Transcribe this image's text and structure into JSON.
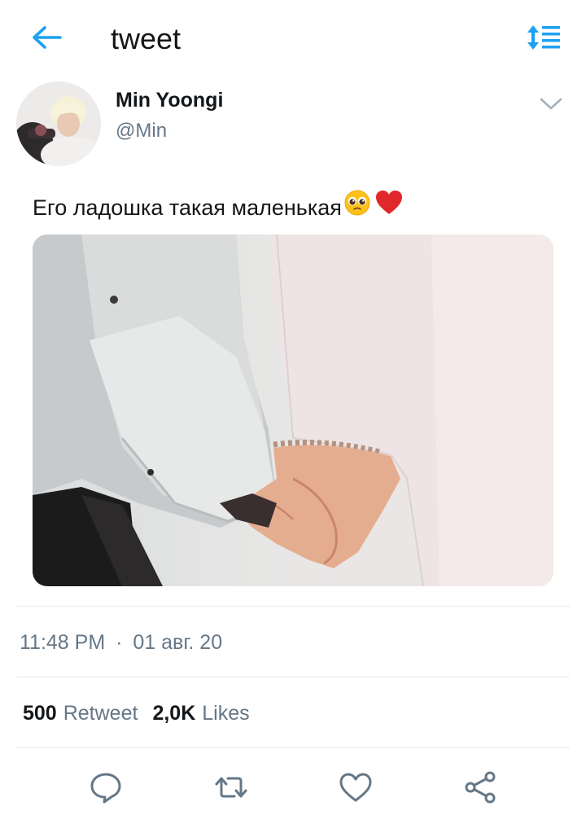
{
  "header": {
    "title": "tweet",
    "back_icon": "arrow-left-icon",
    "sort_icon": "sort-list-icon",
    "accent_color": "#1da1f2"
  },
  "author": {
    "name": "Min Yoongi",
    "handle": "@Min",
    "menu_icon": "chevron-down-icon"
  },
  "tweet": {
    "text": "Его ладошка такая маленькая",
    "emojis": [
      "pleading-face-emoji",
      "red-heart-emoji"
    ],
    "media_description_icon": "photo"
  },
  "meta": {
    "time": "11:48 PM",
    "separator": "·",
    "date": "01 авг. 20"
  },
  "stats": {
    "retweet_count": "500",
    "retweet_label": "Retweet",
    "likes_count": "2,0K",
    "likes_label": "Likes"
  },
  "actions": [
    {
      "name": "reply",
      "icon": "comment-icon"
    },
    {
      "name": "retweet",
      "icon": "retweet-icon"
    },
    {
      "name": "like",
      "icon": "heart-icon"
    },
    {
      "name": "share",
      "icon": "share-icon"
    }
  ],
  "colors": {
    "text_primary": "#14171a",
    "text_secondary": "#657786",
    "divider": "#e1e8ed",
    "heart_emoji": "#e0272c"
  }
}
